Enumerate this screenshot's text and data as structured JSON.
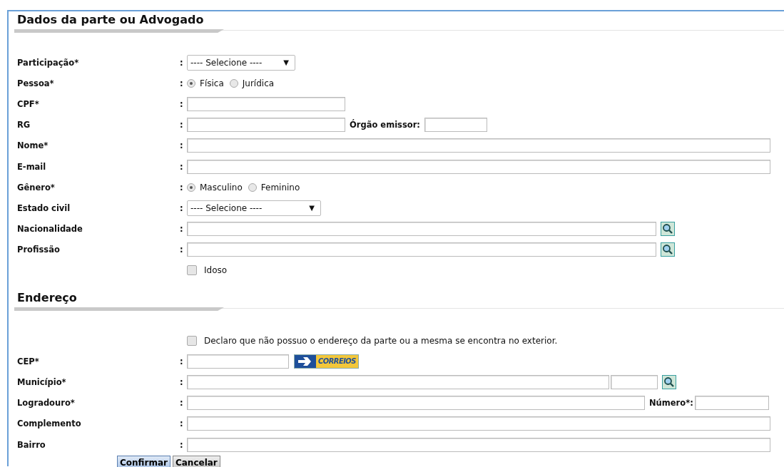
{
  "sections": [
    {
      "title": "Dados da parte ou Advogado",
      "rows": [
        {
          "kind": "select",
          "label": "Participação*",
          "colon": ":",
          "value": "---- Selecione ----",
          "arrow": "▼"
        },
        {
          "kind": "radio",
          "label": "Pessoa*",
          "colon": ":",
          "options": [
            {
              "label": "Física",
              "selected": true
            },
            {
              "label": "Jurídica",
              "selected": false
            }
          ]
        },
        {
          "kind": "short-text",
          "label": "CPF*",
          "colon": ":"
        },
        {
          "kind": "text-extra",
          "label": "RG",
          "colon": ":",
          "extra_label": "Órgão emissor:"
        },
        {
          "kind": "text",
          "label": "Nome*",
          "colon": ":"
        },
        {
          "kind": "text",
          "label": "E-mail",
          "colon": ":"
        },
        {
          "kind": "radio",
          "label": "Gênero*",
          "colon": ":",
          "options": [
            {
              "label": "Masculino",
              "selected": true
            },
            {
              "label": "Feminino",
              "selected": false
            }
          ]
        },
        {
          "kind": "select",
          "label": "Estado civil",
          "colon": ":",
          "value": "---- Selecione ----",
          "arrow": "▼"
        },
        {
          "kind": "lookup",
          "label": "Nacionalidade",
          "colon": ":"
        },
        {
          "kind": "lookup",
          "label": "Profissão",
          "colon": ":"
        },
        {
          "kind": "checkbox",
          "checkbox_label": "Idoso",
          "checked": false
        }
      ]
    },
    {
      "title": "Endereço",
      "rows": [
        {
          "kind": "checkbox",
          "checkbox_label": "Declaro que não possuo o endereço da parte ou a mesma se encontra no exterior.",
          "checked": false
        },
        {
          "kind": "cep",
          "label": "CEP*",
          "colon": ":",
          "logo_text": "CORREIOS"
        },
        {
          "kind": "city",
          "label": "Município*",
          "colon": ":"
        },
        {
          "kind": "street",
          "label": "Logradouro*",
          "colon": ":",
          "extra_label": "Número*:"
        },
        {
          "kind": "text",
          "label": "Complemento",
          "colon": ":"
        },
        {
          "kind": "text",
          "label": "Bairro",
          "colon": ":"
        }
      ]
    }
  ],
  "buttons": [
    {
      "label": "Confirmar",
      "kind": "primary"
    },
    {
      "label": "Cancelar",
      "kind": "secondary"
    }
  ]
}
